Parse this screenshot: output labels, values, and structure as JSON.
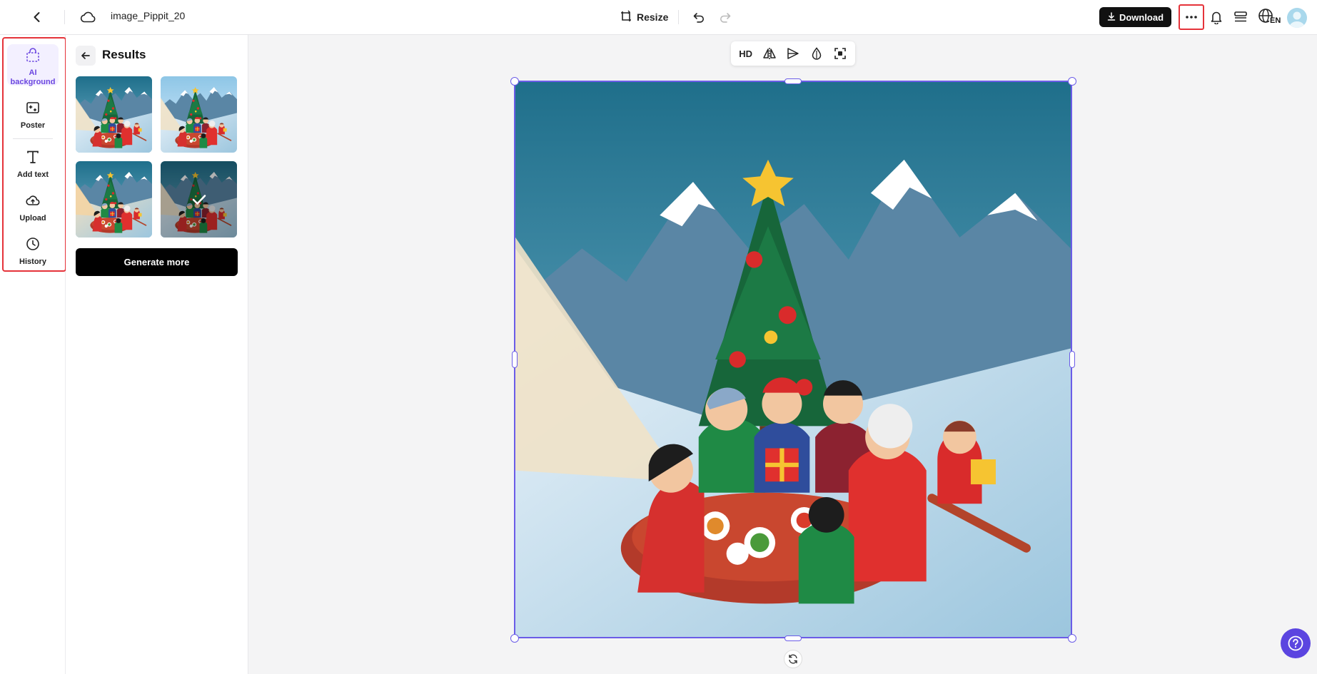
{
  "header": {
    "back_icon": "chevron-left-icon",
    "cloud_icon": "cloud-icon",
    "filename": "image_Pippit_20",
    "resize_label": "Resize",
    "download_label": "Download",
    "language_badge": "EN"
  },
  "left_rail": {
    "items": [
      {
        "label": "AI background",
        "icon": "ai-background-icon",
        "active": true
      },
      {
        "label": "Poster",
        "icon": "poster-icon"
      },
      {
        "label": "Add text",
        "icon": "text-icon"
      },
      {
        "label": "Upload",
        "icon": "upload-icon"
      },
      {
        "label": "History",
        "icon": "history-icon"
      }
    ]
  },
  "panel": {
    "title": "Results",
    "generate_label": "Generate more",
    "thumbnails": [
      {
        "selected": false
      },
      {
        "selected": false
      },
      {
        "selected": false
      },
      {
        "selected": true
      }
    ]
  },
  "canvas": {
    "toolbar": {
      "hd_label": "HD"
    }
  },
  "colors": {
    "accent": "#6b5ce7",
    "highlight": "#e5333a",
    "help": "#5b45e0"
  }
}
